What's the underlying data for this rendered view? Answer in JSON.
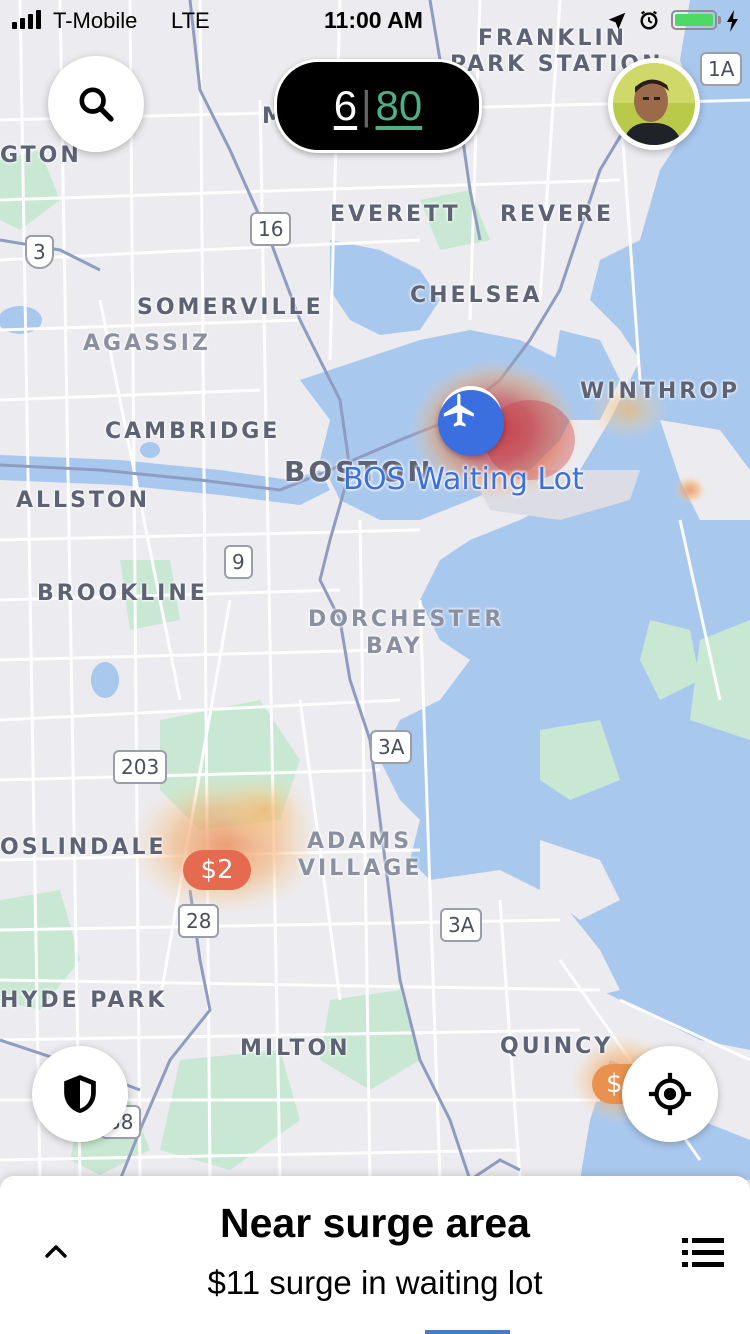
{
  "status_bar": {
    "carrier": "T-Mobile",
    "network": "LTE",
    "time": "11:00 AM"
  },
  "score": {
    "left": "6",
    "divider": "|",
    "right": "80"
  },
  "map": {
    "places": {
      "franklin": "FRANKLIN",
      "park_station": "PARK STATION",
      "gton": "GTON",
      "everett": "EVERETT",
      "revere": "REVERE",
      "somerville": "SOMERVILLE",
      "chelsea": "CHELSEA",
      "agassiz": "AGASSIZ",
      "winthrop": "WINTHROP",
      "cambridge": "CAMBRIDGE",
      "boston": "BOSTON",
      "allston": "ALLSTON",
      "brookline": "BROOKLINE",
      "dorchester": "DORCHESTER",
      "bay": "BAY",
      "oslindale": "OSLINDALE",
      "adams": "ADAMS",
      "village": "VILLAGE",
      "hyde_park": "HYDE PARK",
      "milton": "MILTON",
      "quincy": "QUINCY",
      "m_partial": "M"
    },
    "shields": {
      "r1a": "1A",
      "r16": "16",
      "r3": "3",
      "r9": "9",
      "r3a_1": "3A",
      "r203": "203",
      "r28": "28",
      "r3a_2": "3A",
      "r138": "38"
    },
    "poi_label": "BOS Waiting Lot",
    "surge_badge_1": "$2",
    "surge_badge_2": "$",
    "colors": {
      "water": "#a9c8ee",
      "park": "#c9e8d3",
      "surge_red": "#d9534f",
      "surge_badge": "#e56a4f",
      "poi_blue": "#3b6fe0",
      "score_green": "#4caf86"
    }
  },
  "icons": {
    "search": "search-icon",
    "avatar": "driver-avatar",
    "safety": "shield-icon",
    "locate": "locate-icon",
    "expand": "chevron-up-icon",
    "list": "list-icon"
  },
  "bottom_panel": {
    "title": "Near surge area",
    "subtitle": "$11 surge in waiting lot"
  }
}
